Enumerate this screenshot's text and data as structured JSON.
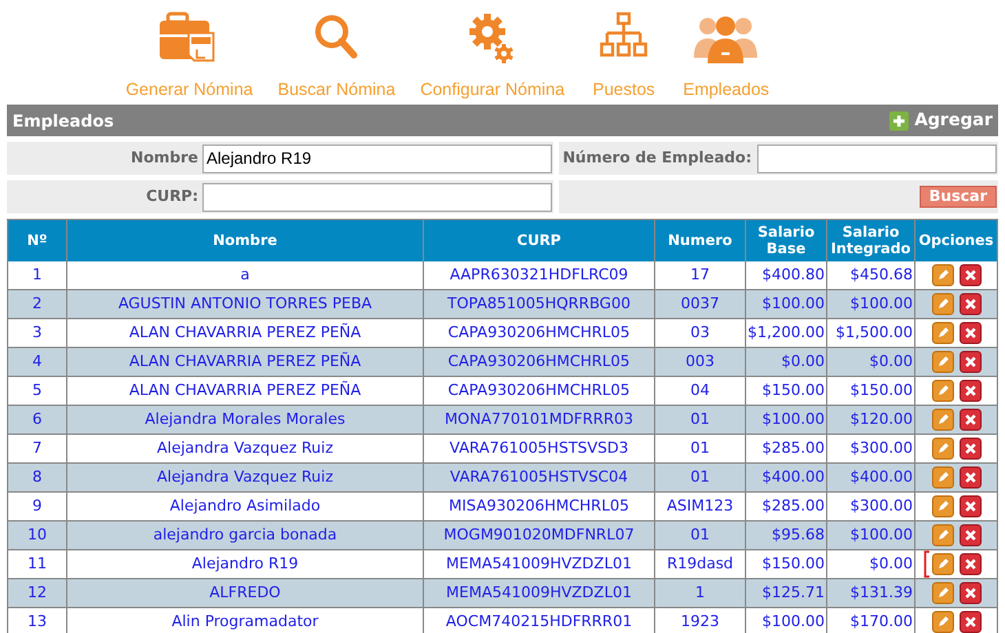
{
  "nav": [
    {
      "label": "Generar Nómina",
      "kind": "payroll"
    },
    {
      "label": "Buscar Nómina",
      "kind": "search"
    },
    {
      "label": "Configurar Nómina",
      "kind": "gears"
    },
    {
      "label": "Puestos",
      "kind": "org"
    },
    {
      "label": "Empleados",
      "kind": "people"
    }
  ],
  "panel": {
    "title": "Empleados",
    "add_label": "Agregar"
  },
  "search": {
    "name_label": "Nombre",
    "name_value": "Alejandro R19",
    "number_label": "Número de Empleado:",
    "curp_label": "CURP:",
    "button": "Buscar"
  },
  "table": {
    "columns": [
      "Nº",
      "Nombre",
      "CURP",
      "Numero",
      "Salario Base",
      "Salario Integrado",
      "Opciones"
    ],
    "rows": [
      {
        "n": "1",
        "name": "a",
        "curp": "AAPR630321HDFLRC09",
        "numero": "17",
        "base": "$400.80",
        "integrado": "$450.68",
        "marked": false
      },
      {
        "n": "2",
        "name": "AGUSTIN ANTONIO TORRES PEBA",
        "curp": "TOPA851005HQRRBG00",
        "numero": "0037",
        "base": "$100.00",
        "integrado": "$100.00",
        "marked": false
      },
      {
        "n": "3",
        "name": "ALAN CHAVARRIA PEREZ PEÑA",
        "curp": "CAPA930206HMCHRL05",
        "numero": "03",
        "base": "$1,200.00",
        "integrado": "$1,500.00",
        "marked": false
      },
      {
        "n": "4",
        "name": "ALAN CHAVARRIA PEREZ PEÑA",
        "curp": "CAPA930206HMCHRL05",
        "numero": "003",
        "base": "$0.00",
        "integrado": "$0.00",
        "marked": false
      },
      {
        "n": "5",
        "name": "ALAN CHAVARRIA PEREZ PEÑA",
        "curp": "CAPA930206HMCHRL05",
        "numero": "04",
        "base": "$150.00",
        "integrado": "$150.00",
        "marked": false
      },
      {
        "n": "6",
        "name": "Alejandra Morales Morales",
        "curp": "MONA770101MDFRRR03",
        "numero": "01",
        "base": "$100.00",
        "integrado": "$120.00",
        "marked": false
      },
      {
        "n": "7",
        "name": "Alejandra Vazquez Ruiz",
        "curp": "VARA761005HSTSVSD3",
        "numero": "01",
        "base": "$285.00",
        "integrado": "$300.00",
        "marked": false
      },
      {
        "n": "8",
        "name": "Alejandra Vazquez Ruiz",
        "curp": "VARA761005HSTVSC04",
        "numero": "01",
        "base": "$400.00",
        "integrado": "$400.00",
        "marked": false
      },
      {
        "n": "9",
        "name": "Alejandro Asimilado",
        "curp": "MISA930206HMCHRL05",
        "numero": "ASIM123",
        "base": "$285.00",
        "integrado": "$300.00",
        "marked": false
      },
      {
        "n": "10",
        "name": "alejandro garcia bonada",
        "curp": "MOGM901020MDFNRL07",
        "numero": "01",
        "base": "$95.68",
        "integrado": "$100.00",
        "marked": false
      },
      {
        "n": "11",
        "name": "Alejandro R19",
        "curp": "MEMA541009HVZDZL01",
        "numero": "R19dasd",
        "base": "$150.00",
        "integrado": "$0.00",
        "marked": true
      },
      {
        "n": "12",
        "name": "ALFREDO",
        "curp": "MEMA541009HVZDZL01",
        "numero": "1",
        "base": "$125.71",
        "integrado": "$131.39",
        "marked": false
      },
      {
        "n": "13",
        "name": "Alin Programadator",
        "curp": "AOCM740215HDFRRR01",
        "numero": "1923",
        "base": "$100.00",
        "integrado": "$170.00",
        "marked": false
      }
    ]
  }
}
